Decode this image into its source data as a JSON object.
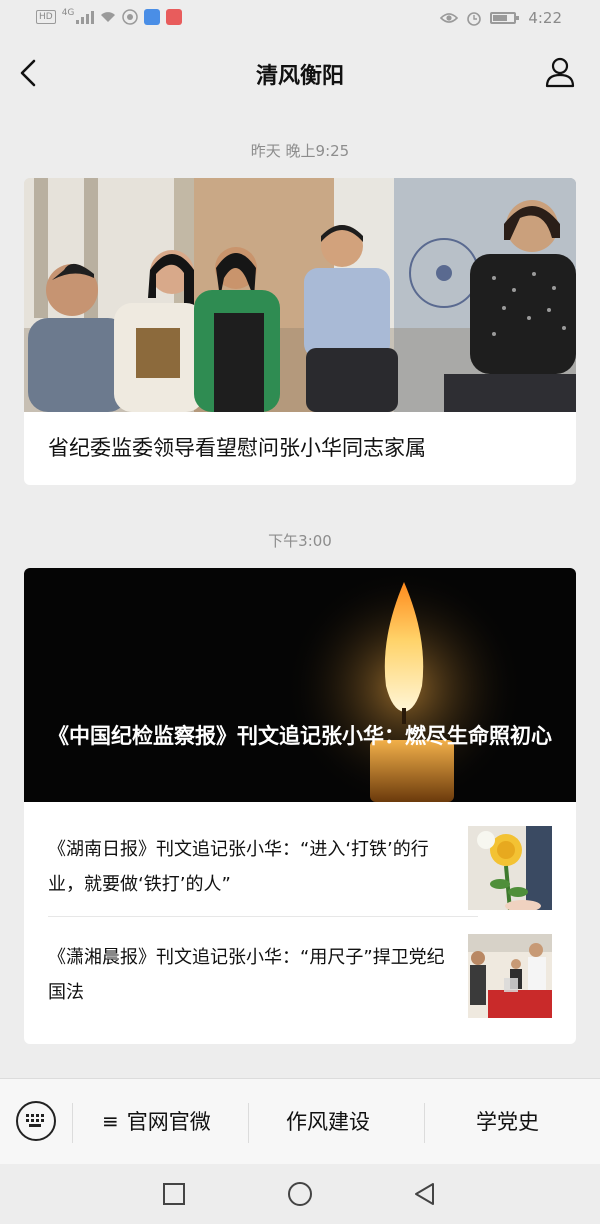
{
  "status_bar": {
    "hd": "HD",
    "network": "4G",
    "time": "4:22"
  },
  "navbar": {
    "title": "清风衡阳"
  },
  "feed": [
    {
      "timestamp": "昨天 晚上9:25",
      "title": "省纪委监委领导看望慰问张小华同志家属"
    },
    {
      "timestamp": "下午3:00",
      "title": "《中国纪检监察报》刊文追记张小华：燃尽生命照初心",
      "items": [
        {
          "title": "《湖南日报》刊文追记张小华：“进入‘打铁’的行业，就要做‘铁打’的人”"
        },
        {
          "title": "《潇湘晨报》刊文追记张小华：“用尺子”捍卫党纪国法"
        }
      ]
    }
  ],
  "bottom_menu": {
    "items": [
      {
        "label": "官网官微",
        "prefix": "≡"
      },
      {
        "label": "作风建设"
      },
      {
        "label": "学党史"
      }
    ]
  },
  "colors": {
    "background": "#ededed",
    "card": "#ffffff",
    "muted_text": "#8d8d8d"
  }
}
